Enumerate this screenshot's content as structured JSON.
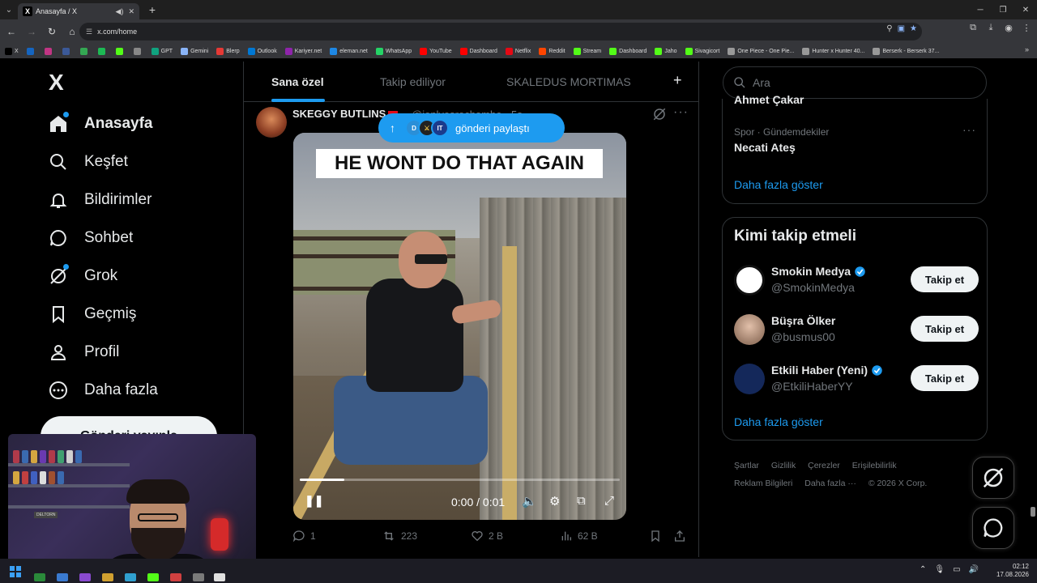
{
  "browser": {
    "tab_title": "Anasayfa / X",
    "tab_favicon": "X",
    "url": "x.com/home",
    "bookmarks": [
      {
        "label": "X",
        "color": "#000000"
      },
      {
        "label": "",
        "color": "#1565c0"
      },
      {
        "label": "",
        "color": "#c13584"
      },
      {
        "label": "",
        "color": "#3b5998"
      },
      {
        "label": "",
        "color": "#34a853"
      },
      {
        "label": "",
        "color": "#1db954"
      },
      {
        "label": "",
        "color": "#53fc18"
      },
      {
        "label": "",
        "color": "#888888"
      },
      {
        "label": "GPT",
        "color": "#10a37f"
      },
      {
        "label": "Gemini",
        "color": "#8ab4f8"
      },
      {
        "label": "Blerp",
        "color": "#e53935"
      },
      {
        "label": "Outlook",
        "color": "#0078d4"
      },
      {
        "label": "Kariyer.net",
        "color": "#8e24aa"
      },
      {
        "label": "eleman.net",
        "color": "#1e88e5"
      },
      {
        "label": "WhatsApp",
        "color": "#25d366"
      },
      {
        "label": "YouTube",
        "color": "#ff0000"
      },
      {
        "label": "Dashboard",
        "color": "#ff0000"
      },
      {
        "label": "Netflix",
        "color": "#e50914"
      },
      {
        "label": "Reddit",
        "color": "#ff4500"
      },
      {
        "label": "Stream",
        "color": "#53fc18"
      },
      {
        "label": "Dashboard",
        "color": "#53fc18"
      },
      {
        "label": "Jaho",
        "color": "#53fc18"
      },
      {
        "label": "Sivagicort",
        "color": "#53fc18"
      },
      {
        "label": "One Piece - One Pie...",
        "color": "#999999"
      },
      {
        "label": "Hunter x Hunter 40...",
        "color": "#999999"
      },
      {
        "label": "Berserk - Berserk 37...",
        "color": "#999999"
      }
    ]
  },
  "sidebar": {
    "logo": "X",
    "items": [
      {
        "label": "Anasayfa",
        "icon": "home-icon"
      },
      {
        "label": "Keşfet",
        "icon": "search-icon"
      },
      {
        "label": "Bildirimler",
        "icon": "bell-icon"
      },
      {
        "label": "Sohbet",
        "icon": "chat-icon"
      },
      {
        "label": "Grok",
        "icon": "grok-icon"
      },
      {
        "label": "Geçmiş",
        "icon": "bookmark-icon"
      },
      {
        "label": "Profil",
        "icon": "person-icon"
      },
      {
        "label": "Daha fazla",
        "icon": "more-circle-icon"
      }
    ],
    "post_button": "Gönderi yayınla"
  },
  "feed": {
    "tabs": [
      "Sana özel",
      "Takip ediliyor",
      "SKALEDUS MORTIMAS"
    ],
    "share_pill": "gönderi paylaştı",
    "tweet": {
      "name": "SKEGGY BUTLINS",
      "handle": "@jonlyesrochambe · 5s",
      "video_caption": "HE WONT DO THAT AGAIN",
      "time": "0:00 / 0:01",
      "progress": 0.14,
      "replies": "1",
      "retweets": "223",
      "likes": "2 B",
      "views": "62 B"
    }
  },
  "right": {
    "search_placeholder": "Ara",
    "trend_partial": "Ahmet Çakar",
    "trend_meta": "Spor · Gündemdekiler",
    "trend_title": "Necati Ateş",
    "show_more": "Daha fazla göster",
    "who_title": "Kimi takip etmeli",
    "who": [
      {
        "name": "Smokin Medya",
        "handle": "@SmokinMedya",
        "verified": true,
        "button": "Takip et"
      },
      {
        "name": "Büşra Ölker",
        "handle": "@busmus00",
        "verified": false,
        "button": "Takip et"
      },
      {
        "name": "Etkili Haber (Yeni)",
        "handle": "@EtkiliHaberYY",
        "verified": true,
        "button": "Takip et"
      }
    ],
    "show_more_2": "Daha fazla göster",
    "footer": [
      "Şartlar",
      "Gizlilik",
      "Çerezler",
      "Erişilebilirlik",
      "Reklam Bilgileri",
      "Daha fazla ···",
      "© 2026 X Corp."
    ]
  },
  "webcam": {
    "label": "DELTORN"
  },
  "taskbar": {
    "time": "02:12",
    "date": "17.08.2026"
  },
  "colors": {
    "accent": "#1d9bf0",
    "text": "#e7e9ea",
    "muted": "#71767b",
    "border": "#2f3336"
  }
}
